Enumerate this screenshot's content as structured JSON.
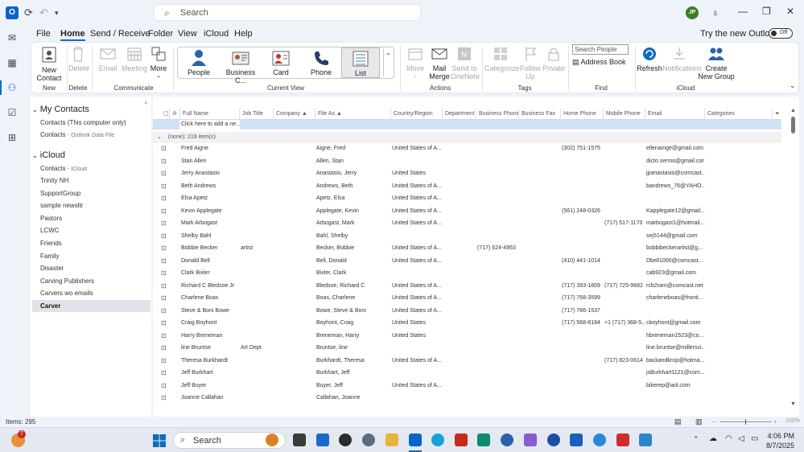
{
  "titlebar": {
    "search_placeholder": "Search",
    "avatar_initials": "JP"
  },
  "menubar": {
    "items": [
      "File",
      "Home",
      "Send / Receive",
      "Folder",
      "View",
      "iCloud",
      "Help"
    ],
    "try_new": "Try the new Outlook",
    "toggle": "Off"
  },
  "ribbon": {
    "new_contact": "New Contact",
    "delete": "Delete",
    "email": "Email",
    "meeting": "Meeting",
    "more": "More",
    "views": [
      "People",
      "Business C...",
      "Card",
      "Phone",
      "List"
    ],
    "move": "Move",
    "mail_merge": "Mail Merge",
    "send_onenote": "Send to OneNote",
    "categorize": "Categorize",
    "follow_up": "Follow Up",
    "private": "Private",
    "search_people": "Search People",
    "address_book": "Address Book",
    "refresh": "Refresh",
    "notifications": "Notifications",
    "create_group": "Create New Group",
    "groups": {
      "new": "New",
      "delete": "Delete",
      "communicate": "Communicate",
      "current_view": "Current View",
      "actions": "Actions",
      "tags": "Tags",
      "find": "Find",
      "icloud": "iCloud"
    }
  },
  "nav": {
    "my_contacts": "My Contacts",
    "contacts_computer": "Contacts (This computer only)",
    "contacts": "Contacts",
    "contacts_sub": "Outlook Data File",
    "icloud": "iCloud",
    "icloud_contacts": "Contacts",
    "icloud_contacts_sub": "iCloud",
    "folders": [
      "Trinity NH",
      "SupportGroup",
      "sample newsltr",
      "Pastors",
      "LCWC",
      "Friends",
      "Family",
      "Disaster",
      "Carving Publishers",
      "Carvers wo emails",
      "Carver"
    ]
  },
  "list": {
    "columns": [
      "Full Name",
      "Job Title",
      "Company",
      "File As",
      "Country/Region",
      "Department",
      "Business Phone",
      "Business Fax",
      "Home Phone",
      "Mobile Phone",
      "Email",
      "Categories"
    ],
    "add_new": "Click here to add a ne...",
    "group_header": "(none): 218 item(s)",
    "rows": [
      {
        "name": "Fred Aigne",
        "job": "",
        "file_as": "Aigne, Fred",
        "country": "United States of A...",
        "bphone": "",
        "hphone": "(302) 751-1575",
        "mphone": "",
        "email": "ellenainge@gmail.com"
      },
      {
        "name": "Stan Allen",
        "job": "",
        "file_as": "Allen, Stan",
        "country": "",
        "bphone": "",
        "hphone": "",
        "mphone": "",
        "email": "dicto.sermo@gmail.com"
      },
      {
        "name": "Jerry Anastasio",
        "job": "",
        "file_as": "Anastasio, Jerry",
        "country": "United States",
        "bphone": "",
        "hphone": "",
        "mphone": "",
        "email": "jpanastasio@comcast..."
      },
      {
        "name": "Beth Andrews",
        "job": "",
        "file_as": "Andrews, Beth",
        "country": "United States of A...",
        "bphone": "",
        "hphone": "",
        "mphone": "",
        "email": "bandrews_76@YAHO..."
      },
      {
        "name": "Elsa Apetz",
        "job": "",
        "file_as": "Apetz, Elsa",
        "country": "United States of A...",
        "bphone": "",
        "hphone": "",
        "mphone": "",
        "email": ""
      },
      {
        "name": "Kevin Applegate",
        "job": "",
        "file_as": "Applegate, Kevin",
        "country": "United States of A...",
        "bphone": "",
        "hphone": "(561) 248-0326",
        "mphone": "",
        "email": "Kapplegate12@gmail..."
      },
      {
        "name": "Mark Arbogast",
        "job": "",
        "file_as": "Arbogast, Mark",
        "country": "United States of A...",
        "bphone": "",
        "hphone": "",
        "mphone": "(717) 517-1170",
        "email": "marbogast1@hotmail..."
      },
      {
        "name": "Shelby Bahl",
        "job": "",
        "file_as": "Bahl, Shelby",
        "country": "",
        "bphone": "",
        "hphone": "",
        "mphone": "",
        "email": "sej5144@gmail.com"
      },
      {
        "name": "Bobbie Becker",
        "job": "artist",
        "file_as": "Becker, Bobbie",
        "country": "United States of A...",
        "bphone": "(717) 624-4953",
        "hphone": "",
        "mphone": "",
        "email": "bobbibeckerartist@g..."
      },
      {
        "name": "Donald Bell",
        "job": "",
        "file_as": "Bell, Donald",
        "country": "United States of A...",
        "bphone": "",
        "hphone": "(410) 441-1014",
        "mphone": "",
        "email": "Dbell1000@comcast..."
      },
      {
        "name": "Clark Bixler",
        "job": "",
        "file_as": "Bixler, Clark",
        "country": "",
        "bphone": "",
        "hphone": "",
        "mphone": "",
        "email": "cab923@gmail.com"
      },
      {
        "name": "Richard C Bledsoe Jr",
        "job": "",
        "file_as": "Bledsoe, Richard C",
        "country": "United States of A...",
        "bphone": "",
        "hphone": "(717) 393-1809",
        "mphone": "(717) 725-9682",
        "email": "rcb2ram@comcast.net"
      },
      {
        "name": "Charlene Boas",
        "job": "",
        "file_as": "Boas, Charlene",
        "country": "United States of A...",
        "bphone": "",
        "hphone": "(717) 768-3599",
        "mphone": "",
        "email": "charleneboas@fronti..."
      },
      {
        "name": "Steve & Boni Bowe",
        "job": "",
        "file_as": "Bowe, Steve & Boni",
        "country": "United States of A...",
        "bphone": "",
        "hphone": "(717) 786-1537",
        "mphone": "",
        "email": ""
      },
      {
        "name": "Craig Boyhont",
        "job": "",
        "file_as": "Boyhont, Craig",
        "country": "United States",
        "bphone": "",
        "hphone": "(717) 568-8184",
        "mphone": "+1 (717) 368-5...",
        "email": "cboyhont@gmail.com"
      },
      {
        "name": "Harry Breneman",
        "job": "",
        "file_as": "Breneman, Harry",
        "country": "United States",
        "bphone": "",
        "hphone": "",
        "mphone": "",
        "email": "hbreneman1523@co..."
      },
      {
        "name": "line Bruntse",
        "job": "Art Dept",
        "file_as": "Bruntse, line",
        "country": "",
        "bphone": "",
        "hphone": "",
        "mphone": "",
        "email": "line.bruntse@millersvi..."
      },
      {
        "name": "Theresa Burkhardt",
        "job": "",
        "file_as": "Burkhardt, Theresa",
        "country": "United States of A...",
        "bphone": "",
        "hphone": "",
        "mphone": "(717) 823-0614",
        "email": "backandkrop@hotma..."
      },
      {
        "name": "Jeff Burkhart",
        "job": "",
        "file_as": "Burkhart, Jeff",
        "country": "",
        "bphone": "",
        "hphone": "",
        "mphone": "",
        "email": "jsBurkhart1121@com..."
      },
      {
        "name": "Jeff Buyer",
        "job": "",
        "file_as": "Buyer, Jeff",
        "country": "United States of A...",
        "bphone": "",
        "hphone": "",
        "mphone": "",
        "email": "bikerep@aol.com"
      },
      {
        "name": "Joanne Callahan",
        "job": "",
        "file_as": "Callahan, Joanne",
        "country": "",
        "bphone": "",
        "hphone": "",
        "mphone": "",
        "email": ""
      }
    ]
  },
  "status": {
    "items": "Items: 295",
    "zoom": "100%"
  },
  "taskbar": {
    "search_placeholder": "Search",
    "badge": "7",
    "time": "4:06 PM",
    "date": "8/7/2025"
  },
  "colors": {
    "accent": "#0f6cbd",
    "selection": "#cfe2f7"
  }
}
